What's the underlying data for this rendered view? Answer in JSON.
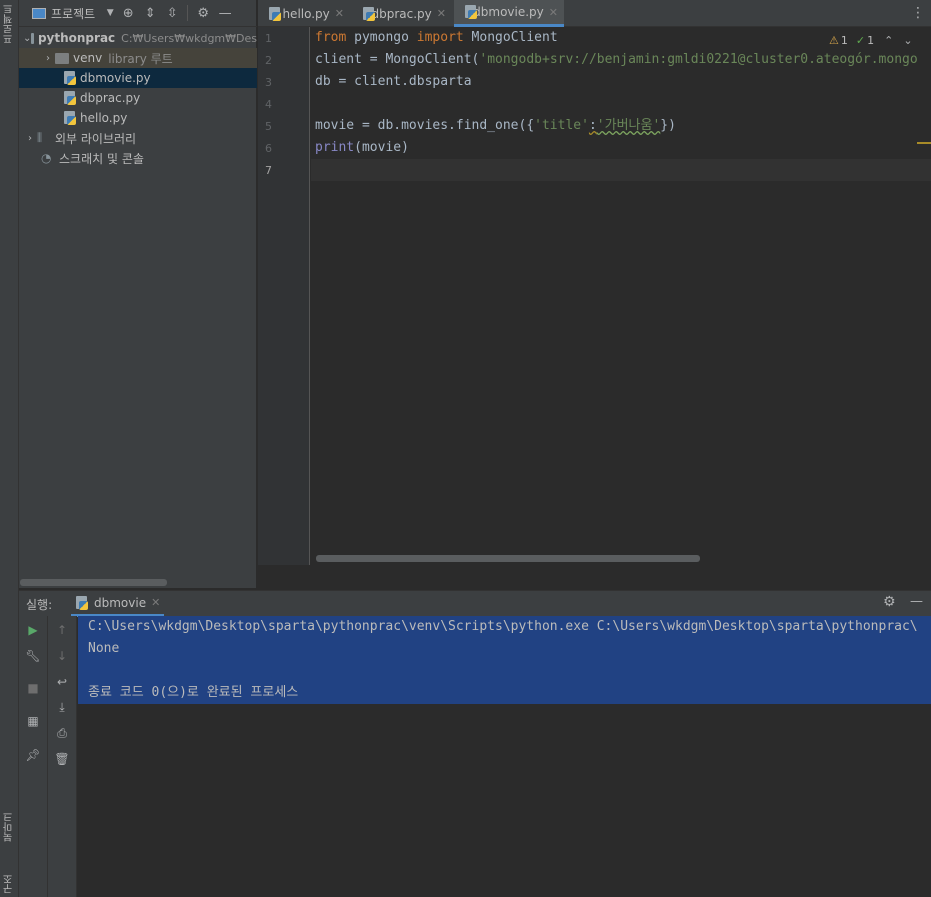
{
  "project_panel": {
    "title": "프로젝트",
    "tree": [
      {
        "name": "pythonprac",
        "path": "C:₩Users₩wkdgm₩Des"
      },
      {
        "name": "venv",
        "suffix": "library 루트"
      },
      {
        "name": "dbmovie.py"
      },
      {
        "name": "dbprac.py"
      },
      {
        "name": "hello.py"
      },
      {
        "name": "외부 라이브러리"
      },
      {
        "name": "스크래치 및 콘솔"
      }
    ]
  },
  "left_strip": {
    "project_tab": "프로젝트",
    "bookmarks_tab": "북마크",
    "structure_tab": "구조"
  },
  "editor": {
    "tabs": [
      {
        "label": "hello.py"
      },
      {
        "label": "dbprac.py"
      },
      {
        "label": "dbmovie.py"
      }
    ],
    "inspection": {
      "warnings": "1",
      "ok": "1"
    },
    "line_numbers": [
      "1",
      "2",
      "3",
      "4",
      "5",
      "6",
      "7"
    ],
    "code": {
      "l1_kw1": "from",
      "l1_mod": " pymongo ",
      "l1_kw2": "import",
      "l1_rest": " MongoClient",
      "l2_pre": "client = MongoClient(",
      "l2_str": "'mongodb+srv://benjamin:gmldi0221@cluster0.ateogór.mongo",
      "l3": "db = client.dbsparta",
      "l5_pre": "movie = db.movies.find_one({",
      "l5_key": "'title'",
      "l5_colon": ":",
      "l5_val": "'가버나움'",
      "l5_post": "})",
      "l6_fn": "print",
      "l6_rest": "(movie)"
    }
  },
  "run_panel": {
    "label": "실행:",
    "tab": "dbmovie",
    "console": [
      "C:\\Users\\wkdgm\\Desktop\\sparta\\pythonprac\\venv\\Scripts\\python.exe C:\\Users\\wkdgm\\Desktop\\sparta\\pythonprac\\",
      "None",
      "",
      "종료 코드 0(으)로 완료된 프로세스"
    ]
  }
}
